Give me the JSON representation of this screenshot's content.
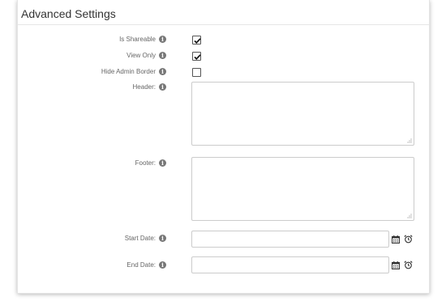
{
  "panel": {
    "title": "Advanced Settings"
  },
  "fields": {
    "is_shareable": {
      "label": "Is Shareable",
      "checked": true
    },
    "view_only": {
      "label": "View Only",
      "checked": true
    },
    "hide_admin_border": {
      "label": "Hide Admin Border",
      "checked": false
    },
    "header": {
      "label": "Header:",
      "value": ""
    },
    "footer": {
      "label": "Footer:",
      "value": ""
    },
    "start_date": {
      "label": "Start Date:",
      "value": ""
    },
    "end_date": {
      "label": "End Date:",
      "value": ""
    }
  },
  "icons": {
    "info": "info-icon",
    "calendar": "calendar-icon",
    "clock": "alarm-clock-icon"
  },
  "info_glyph": "i",
  "colors": {
    "label_text": "#666666",
    "info_icon": "#777777",
    "border": "#cccccc",
    "checkbox_border": "#555555"
  }
}
